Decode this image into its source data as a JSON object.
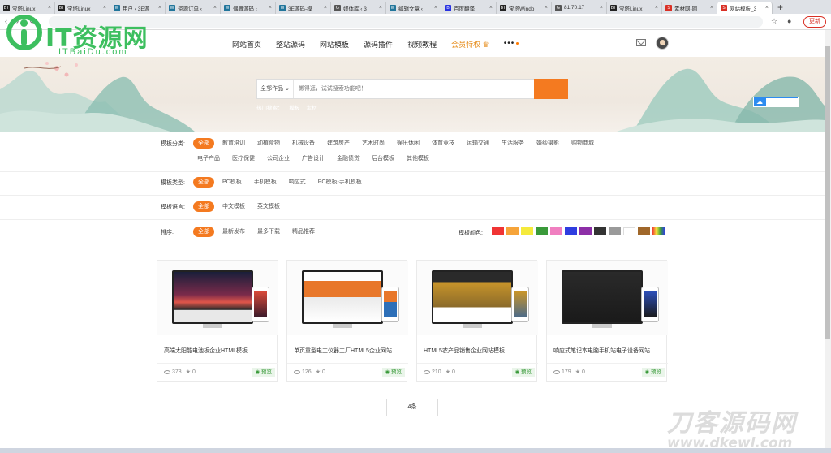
{
  "browser": {
    "tabs": [
      {
        "title": "宝塔Linux",
        "fav": "BT",
        "color": "#222"
      },
      {
        "title": "宝塔Linux",
        "fav": "BT",
        "color": "#222"
      },
      {
        "title": "用户 ‹ 3E源",
        "fav": "W",
        "color": "#21759b"
      },
      {
        "title": "资源订单 ‹",
        "fav": "W",
        "color": "#21759b"
      },
      {
        "title": "偶舞源码 ‹",
        "fav": "W",
        "color": "#21759b"
      },
      {
        "title": "3E源码-模",
        "fav": "W",
        "color": "#21759b"
      },
      {
        "title": "媒体库 ‹ 3",
        "fav": "G",
        "color": "#555"
      },
      {
        "title": "编辑文章 ‹",
        "fav": "W",
        "color": "#21759b"
      },
      {
        "title": "百度翻译",
        "fav": "B",
        "color": "#2932e1"
      },
      {
        "title": "宝塔Windo",
        "fav": "BT",
        "color": "#222"
      },
      {
        "title": "81.70.17",
        "fav": "G",
        "color": "#555"
      },
      {
        "title": "宝塔Linux",
        "fav": "BT",
        "color": "#222"
      },
      {
        "title": "素材网-网",
        "fav": "S",
        "color": "#d93025"
      },
      {
        "title": "网站模板_3",
        "fav": "S",
        "color": "#d93025",
        "active": true
      }
    ],
    "new_tab": "+",
    "update_label": "更新"
  },
  "logo": {
    "title": "IT资源网",
    "subtitle": "ITBaiDu.com"
  },
  "nav": {
    "items": [
      "网站首页",
      "整站源码",
      "网站模板",
      "源码插件",
      "视频教程"
    ],
    "vip": "会员特权",
    "more": "•••"
  },
  "search": {
    "category": "全部作品 ⌄",
    "placeholder": "懒得逛，试试搜索功能吧！",
    "hotwords": [
      "热门搜索：",
      "模板",
      "素材"
    ]
  },
  "filters": {
    "category": {
      "label": "模板分类:",
      "row1": [
        "全部",
        "教育培训",
        "动植食物",
        "机械设备",
        "建筑房产",
        "艺术时尚",
        "娱乐休闲",
        "体育竞技",
        "运输交通",
        "生活服务",
        "婚纱摄影",
        "购物商城"
      ],
      "row2": [
        "电子产品",
        "医疗保健",
        "公司企业",
        "广告设计",
        "金融债贷",
        "后台模板",
        "其他模板"
      ]
    },
    "type": {
      "label": "模板类型:",
      "options": [
        "全部",
        "PC模板",
        "手机模板",
        "响应式",
        "PC模板-手机模板"
      ]
    },
    "language": {
      "label": "模板语言:",
      "options": [
        "全部",
        "中文模板",
        "英文模板"
      ]
    },
    "sort": {
      "label": "排序:",
      "options": [
        "全部",
        "最新发布",
        "最多下载",
        "精品推荐"
      ]
    },
    "colors": {
      "label": "模板颜色:",
      "swatches": [
        "#f03434",
        "#f6a43a",
        "#f5ea3c",
        "#3a9a3a",
        "#f07fc0",
        "#2f3de0",
        "#8d2fa7",
        "#333333",
        "#9a9a9a",
        "#ffffff",
        "#a0672a",
        "rainbow"
      ]
    }
  },
  "cards": [
    {
      "title": "高端太阳能电池板企业HTML模板",
      "views": "378",
      "stars": "0",
      "preview": "预览",
      "scheme": "sunset"
    },
    {
      "title": "单页重型电工仪器工厂HTML5企业网站",
      "views": "126",
      "stars": "0",
      "preview": "预览",
      "scheme": "factory"
    },
    {
      "title": "HTML5农产品销售企业网站模板",
      "views": "210",
      "stars": "0",
      "preview": "预览",
      "scheme": "wheat"
    },
    {
      "title": "响应式笔记本电脑手机站电子设备网站...",
      "views": "179",
      "stars": "0",
      "preview": "预览",
      "scheme": "dark"
    }
  ],
  "pager": {
    "label": "4条"
  },
  "watermark": {
    "title": "刀客源码网",
    "url": "www.dkewl.com"
  }
}
